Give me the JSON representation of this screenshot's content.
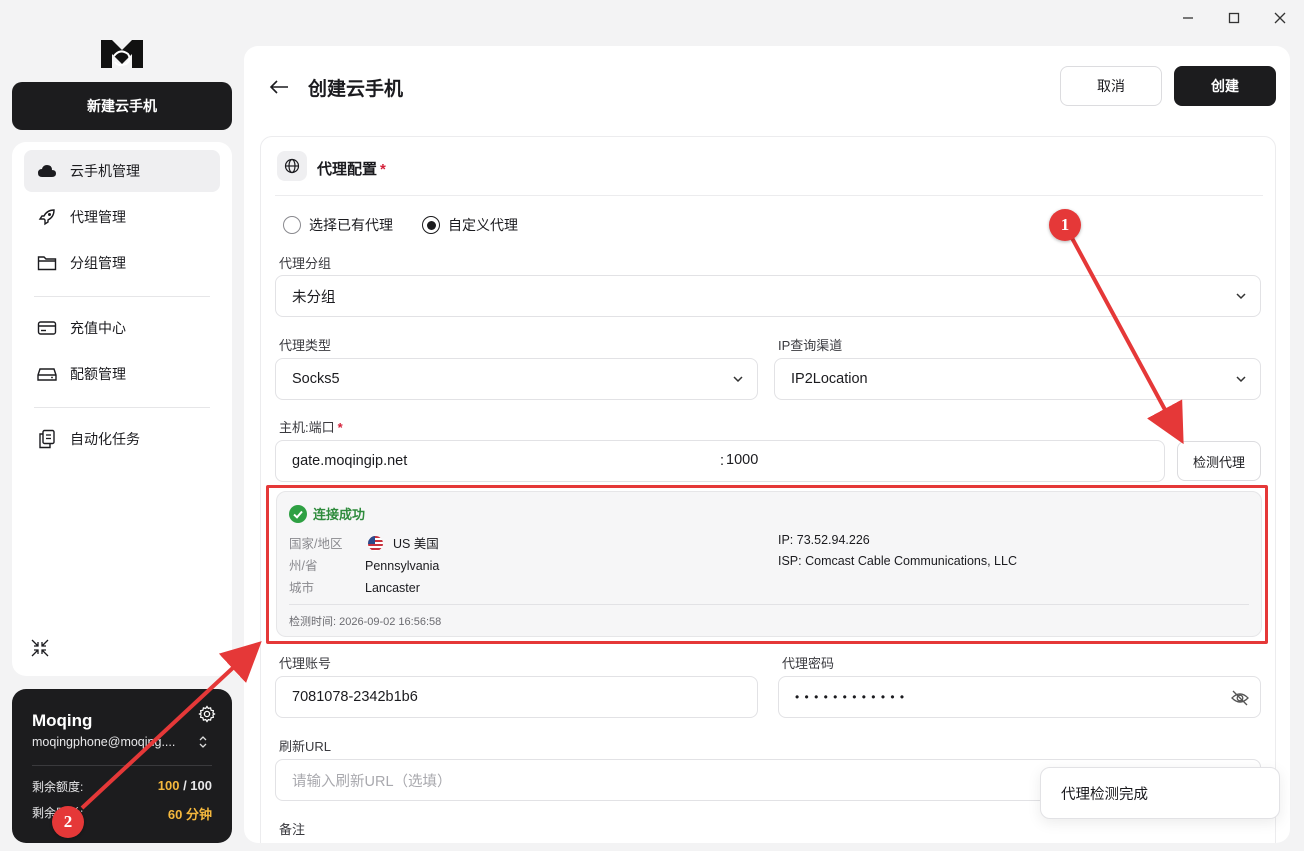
{
  "app": {
    "brand_icon": "moqing-logo"
  },
  "window": {
    "controls": [
      "minimize-icon",
      "maximize-icon",
      "close-icon"
    ]
  },
  "sidebar": {
    "new_button": "新建云手机",
    "items": [
      {
        "label": "云手机管理",
        "icon": "cloud-icon",
        "active": true
      },
      {
        "label": "代理管理",
        "icon": "rocket-icon"
      },
      {
        "label": "分组管理",
        "icon": "folder-icon"
      },
      {
        "label": "充值中心",
        "icon": "credit-card-icon"
      },
      {
        "label": "配额管理",
        "icon": "storage-icon"
      },
      {
        "label": "自动化任务",
        "icon": "clipboard-icon"
      }
    ],
    "collapse_icon": "collapse-icon"
  },
  "user": {
    "name": "Moqing",
    "email": "moqingphone@moqing....",
    "quota_label": "剩余额度:",
    "quota_used": "100",
    "quota_sep": " / ",
    "quota_total": "100",
    "time_label": "剩余时长:",
    "time_value": "60",
    "time_unit": "分钟"
  },
  "header": {
    "title": "创建云手机",
    "cancel": "取消",
    "create": "创建"
  },
  "proxy": {
    "section_title": "代理配置",
    "required_mark": "*",
    "mode_options": [
      "选择已有代理",
      "自定义代理"
    ],
    "mode_selected": 1,
    "group_label": "代理分组",
    "group_value": "未分组",
    "type_label": "代理类型",
    "type_value": "Socks5",
    "ip_channel_label": "IP查询渠道",
    "ip_channel_value": "IP2Location",
    "host_label": "主机:端口",
    "host_value": "gate.moqingip.net",
    "port_sep": ":",
    "port_value": "1000",
    "detect_button": "检测代理",
    "account_label": "代理账号",
    "account_value": "7081078-2342b1b6",
    "password_label": "代理密码",
    "password_masked": "• • • • • • • • • • • •",
    "refresh_label": "刷新URL",
    "refresh_placeholder": "请输入刷新URL（选填）",
    "notes_label": "备注"
  },
  "result": {
    "status": "连接成功",
    "country_key": "国家/地区",
    "country_value": "US 美国",
    "state_key": "州/省",
    "state_value": "Pennsylvania",
    "city_key": "城市",
    "city_value": "Lancaster",
    "ip": "IP: 73.52.94.226",
    "isp": "ISP: Comcast Cable Communications, LLC",
    "time": "检测时间: 2026-09-02 16:56:58"
  },
  "toast": "代理检测完成",
  "annotations": [
    "1",
    "2"
  ],
  "colors": {
    "accent": "#1c1c1e",
    "success": "#2e8b3c",
    "annotation": "#e53838",
    "quota": "#f5b83d"
  }
}
